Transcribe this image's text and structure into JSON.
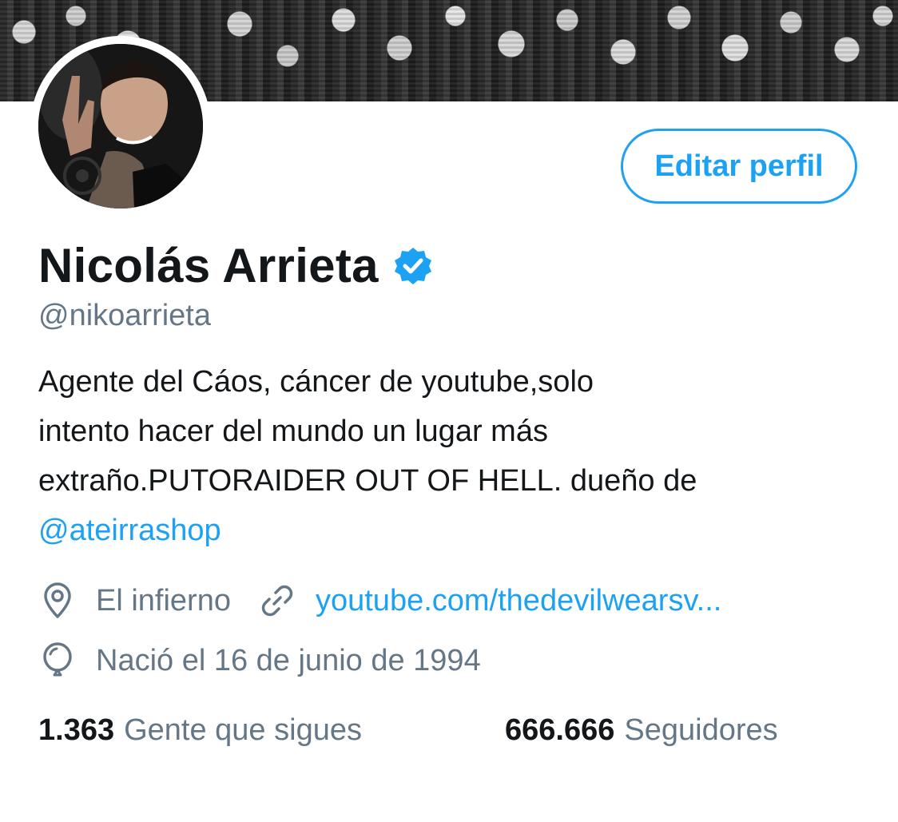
{
  "profile": {
    "name": "Nicolás Arrieta",
    "handle": "@nikoarrieta",
    "bio": {
      "line1": "Agente del Cáos, cáncer de youtube,solo",
      "line2": "intento hacer del mundo un lugar más",
      "line3": "extraño.PUTORAIDER OUT OF HELL. dueño de",
      "mention": "@ateirrashop"
    },
    "location": "El infierno",
    "website": "youtube.com/thedevilwearsv...",
    "birthday": "Nació el 16 de junio de 1994"
  },
  "actions": {
    "edit_profile": "Editar perfil"
  },
  "stats": {
    "following_count": "1.363",
    "following_label": "Gente que sigues",
    "followers_count": "666.666",
    "followers_label": "Seguidores"
  },
  "icons": {
    "verified": "verified-badge-icon",
    "location": "location-pin-icon",
    "link": "link-icon",
    "birthday": "balloon-icon"
  },
  "colors": {
    "accent": "#1da1f2",
    "secondary_text": "#657786",
    "primary_text": "#14171a"
  }
}
